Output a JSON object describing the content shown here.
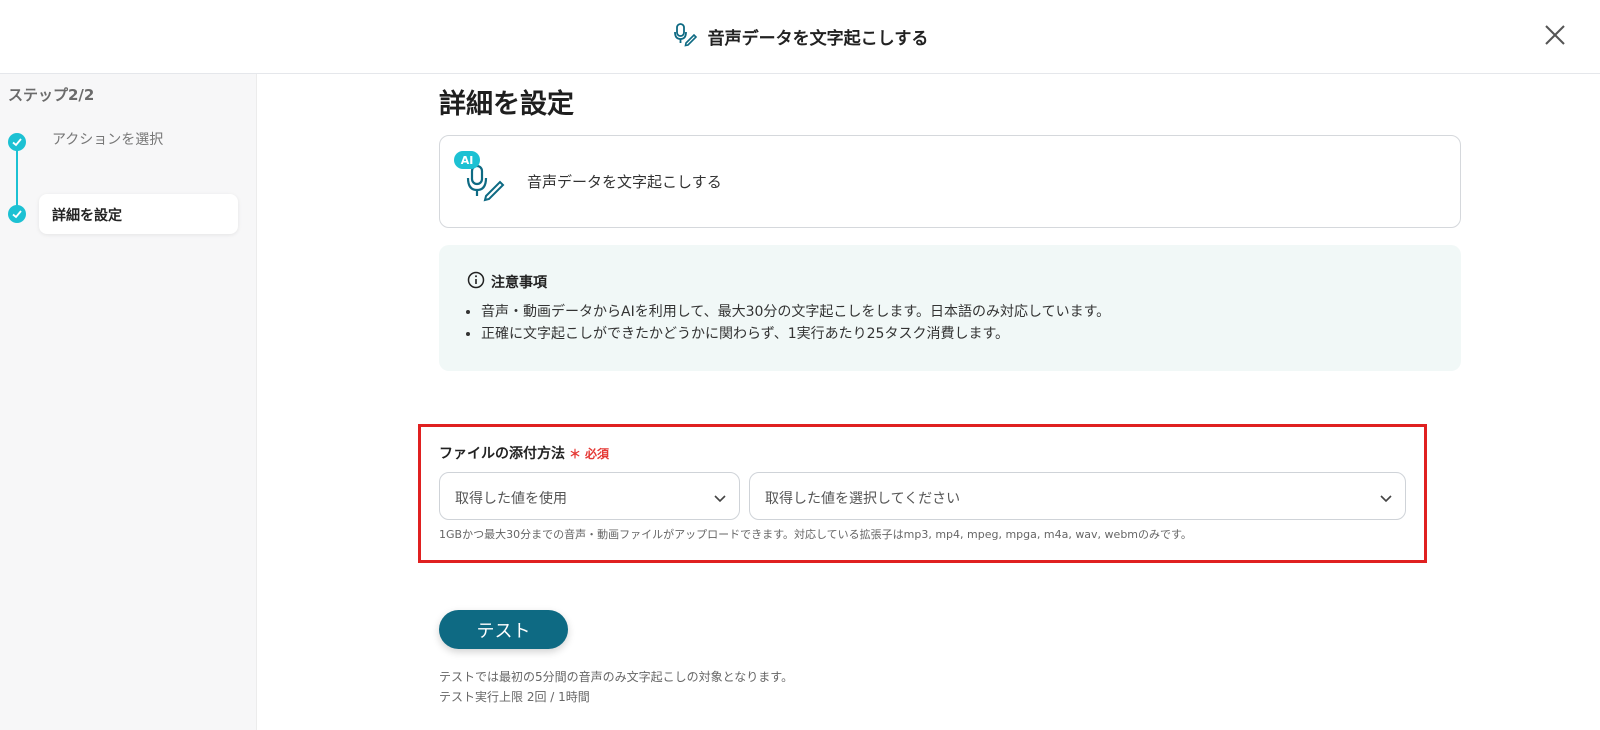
{
  "header": {
    "title": "音声データを文字起こしする",
    "title_icon": "mic-pen-icon",
    "close_icon": "close-icon"
  },
  "sidebar": {
    "step_label": "ステップ2/2",
    "steps": [
      {
        "label": "アクションを選択",
        "status": "done"
      },
      {
        "label": "詳細を設定",
        "status": "current"
      }
    ]
  },
  "main": {
    "heading": "詳細を設定",
    "action_card": {
      "badge": "AI",
      "label": "音声データを文字起こしする"
    },
    "notice": {
      "title": "注意事項",
      "items": [
        "音声・動画データからAIを利用して、最大30分の文字起こしをします。日本語のみ対応しています。",
        "正確に文字起こしができたかどうかに関わらず、1実行あたり25タスク消費します。"
      ]
    },
    "file_field": {
      "label": "ファイルの添付方法",
      "required_mark": "＊",
      "required_text": "必須",
      "method_value": "取得した値を使用",
      "value_placeholder": "取得した値を選択してください",
      "help": "1GBかつ最大30分までの音声・動画ファイルがアップロードできます。対応している拡張子はmp3, mp4, mpeg, mpga, m4a, wav, webmのみです。"
    },
    "test_button": "テスト",
    "test_notes": [
      "テストでは最初の5分間の音声のみ文字起こしの対象となります。",
      "テスト実行上限 2回 / 1時間"
    ]
  },
  "colors": {
    "accent": "#1cc1d3",
    "primary_button": "#0e6a83",
    "notice_bg": "#f1f8f7",
    "required": "#e53935",
    "highlight_border": "#e02020"
  }
}
